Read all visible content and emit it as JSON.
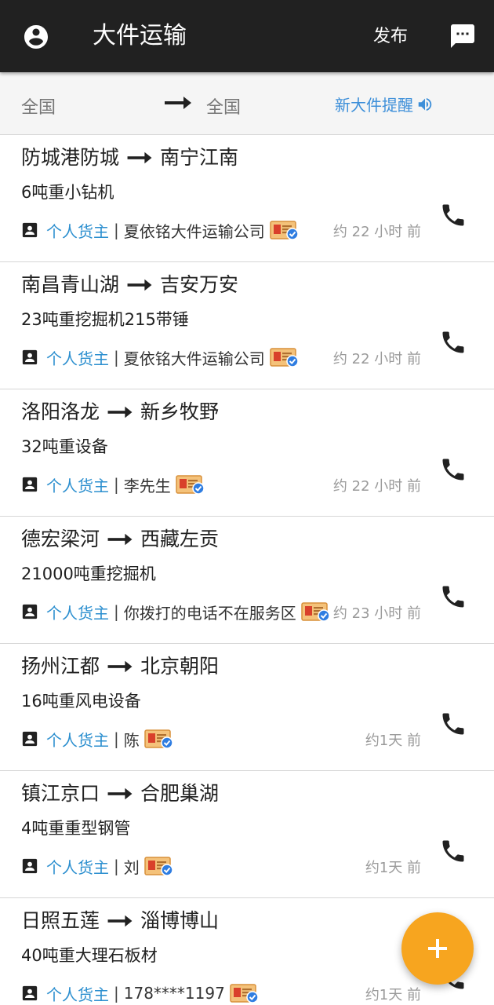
{
  "appbar": {
    "title": "大件运输",
    "publish_label": "发布",
    "account_icon": "account-circle-icon",
    "message_icon": "chat-icon"
  },
  "filter": {
    "from": "全国",
    "to": "全国",
    "remind_label": "新大件提醒",
    "accent": "#3d8fd9"
  },
  "items": [
    {
      "from": "防城港防城",
      "to": "南宁江南",
      "cargo": "6吨重小钻机",
      "owner_type": "个人货主",
      "sep": "|",
      "company": "夏依铭大件运输公司",
      "time": "约 22 小时 前"
    },
    {
      "from": "南昌青山湖",
      "to": "吉安万安",
      "cargo": "23吨重挖掘机215带锤",
      "owner_type": "个人货主",
      "sep": "|",
      "company": "夏依铭大件运输公司",
      "time": "约 22 小时 前"
    },
    {
      "from": "洛阳洛龙",
      "to": "新乡牧野",
      "cargo": "32吨重设备",
      "owner_type": "个人货主",
      "sep": "|",
      "company": "李先生",
      "time": "约 22 小时 前"
    },
    {
      "from": "德宏梁河",
      "to": "西藏左贡",
      "cargo": "21000吨重挖掘机",
      "owner_type": "个人货主",
      "sep": "|",
      "company": "你拨打的电话不在服务区",
      "time": "约 23 小时 前"
    },
    {
      "from": "扬州江都",
      "to": "北京朝阳",
      "cargo": "16吨重风电设备",
      "owner_type": "个人货主",
      "sep": "|",
      "company": "陈",
      "time": "约1天 前"
    },
    {
      "from": "镇江京口",
      "to": "合肥巢湖",
      "cargo": "4吨重重型钢管",
      "owner_type": "个人货主",
      "sep": "|",
      "company": "刘",
      "time": "约1天 前"
    },
    {
      "from": "日照五莲",
      "to": "淄博博山",
      "cargo": "40吨重大理石板材",
      "owner_type": "个人货主",
      "sep": "|",
      "company": "178****1197",
      "time": "约1天 前"
    }
  ],
  "colors": {
    "appbar": "#212121",
    "owner_link": "#2c8fcf",
    "fab": "#f7a51f"
  }
}
